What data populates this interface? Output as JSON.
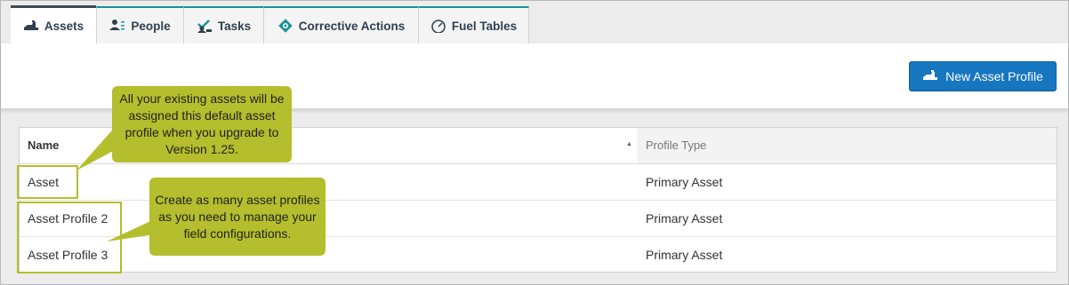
{
  "tabs": [
    {
      "label": "Assets",
      "icon": "asset-icon",
      "active": true
    },
    {
      "label": "People",
      "icon": "people-icon",
      "active": false
    },
    {
      "label": "Tasks",
      "icon": "tasks-icon",
      "active": false
    },
    {
      "label": "Corrective Actions",
      "icon": "corrective-action-icon",
      "active": false
    },
    {
      "label": "Fuel Tables",
      "icon": "gauge-icon",
      "active": false
    }
  ],
  "toolbar": {
    "new_button_label": "New Asset Profile",
    "new_button_icon": "asset-icon"
  },
  "table": {
    "headers": {
      "name": "Name",
      "profile_type": "Profile Type"
    },
    "sort": "ascending",
    "rows": [
      {
        "name": "Asset",
        "profile_type": "Primary Asset"
      },
      {
        "name": "Asset Profile 2",
        "profile_type": "Primary Asset"
      },
      {
        "name": "Asset Profile 3",
        "profile_type": "Primary Asset"
      }
    ]
  },
  "callouts": {
    "default_profile": "All your existing assets will be assigned this default asset profile when you upgrade to Version 1.25.",
    "create_profiles": "Create as many asset profiles as you need to manage your field configurations."
  },
  "colors": {
    "accent_teal": "#1a9396",
    "button_blue": "#1776c0",
    "callout_olive": "#b5be2c"
  }
}
